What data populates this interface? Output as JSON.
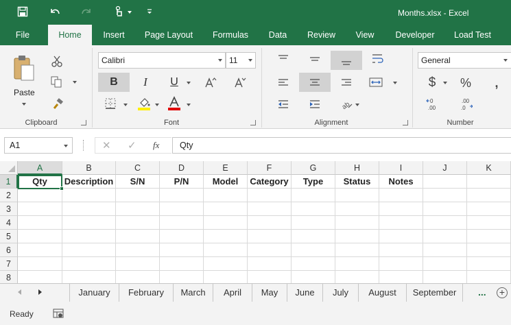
{
  "window": {
    "title": "Months.xlsx - Excel",
    "accent": "#217346"
  },
  "quick_access": {
    "save_icon": "save-icon",
    "undo_icon": "undo-icon",
    "redo_icon": "redo-icon",
    "touch_icon": "touch-mode-icon",
    "customize_icon": "customize-qat-icon"
  },
  "ribbon_tabs": [
    "File",
    "Home",
    "Insert",
    "Page Layout",
    "Formulas",
    "Data",
    "Review",
    "View",
    "Developer",
    "Load Test"
  ],
  "active_tab": "Home",
  "ribbon": {
    "clipboard": {
      "label": "Clipboard",
      "paste": "Paste"
    },
    "font": {
      "label": "Font",
      "font_name": "Calibri",
      "font_size": "11"
    },
    "alignment": {
      "label": "Alignment"
    },
    "number": {
      "label": "Number",
      "format": "General"
    }
  },
  "formula_bar": {
    "name_box": "A1",
    "fx": "fx",
    "content": "Qty"
  },
  "grid": {
    "columns": [
      "A",
      "B",
      "C",
      "D",
      "E",
      "F",
      "G",
      "H",
      "I",
      "J",
      "K"
    ],
    "rows": [
      "1",
      "2",
      "3",
      "4",
      "5",
      "6",
      "7",
      "8"
    ],
    "header_row": [
      "Qty",
      "Description",
      "S/N",
      "P/N",
      "Model",
      "Category",
      "Type",
      "Status",
      "Notes",
      "",
      ""
    ]
  },
  "sheet_tabs": [
    "January",
    "February",
    "March",
    "April",
    "May",
    "June",
    "July",
    "August",
    "September"
  ],
  "sheet_more": "...",
  "status": {
    "text": "Ready"
  }
}
